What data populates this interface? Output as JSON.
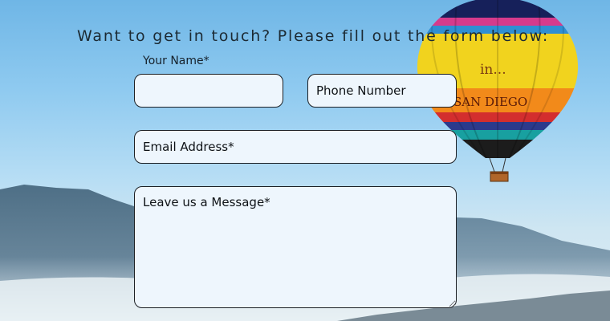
{
  "form": {
    "heading": "Want to get in touch? Please fill out the form below:",
    "name_label": "Your Name*",
    "name_value": "",
    "phone_placeholder": "Phone Number",
    "email_placeholder": "Email Address*",
    "message_placeholder": "Leave us a Message*"
  },
  "balloon": {
    "text_line1": "in...",
    "text_line2": "SAN DIEGO"
  },
  "colors": {
    "field_bg": "#eef6fd",
    "field_border": "#1b1f24",
    "sky": "#8fcaf0"
  }
}
